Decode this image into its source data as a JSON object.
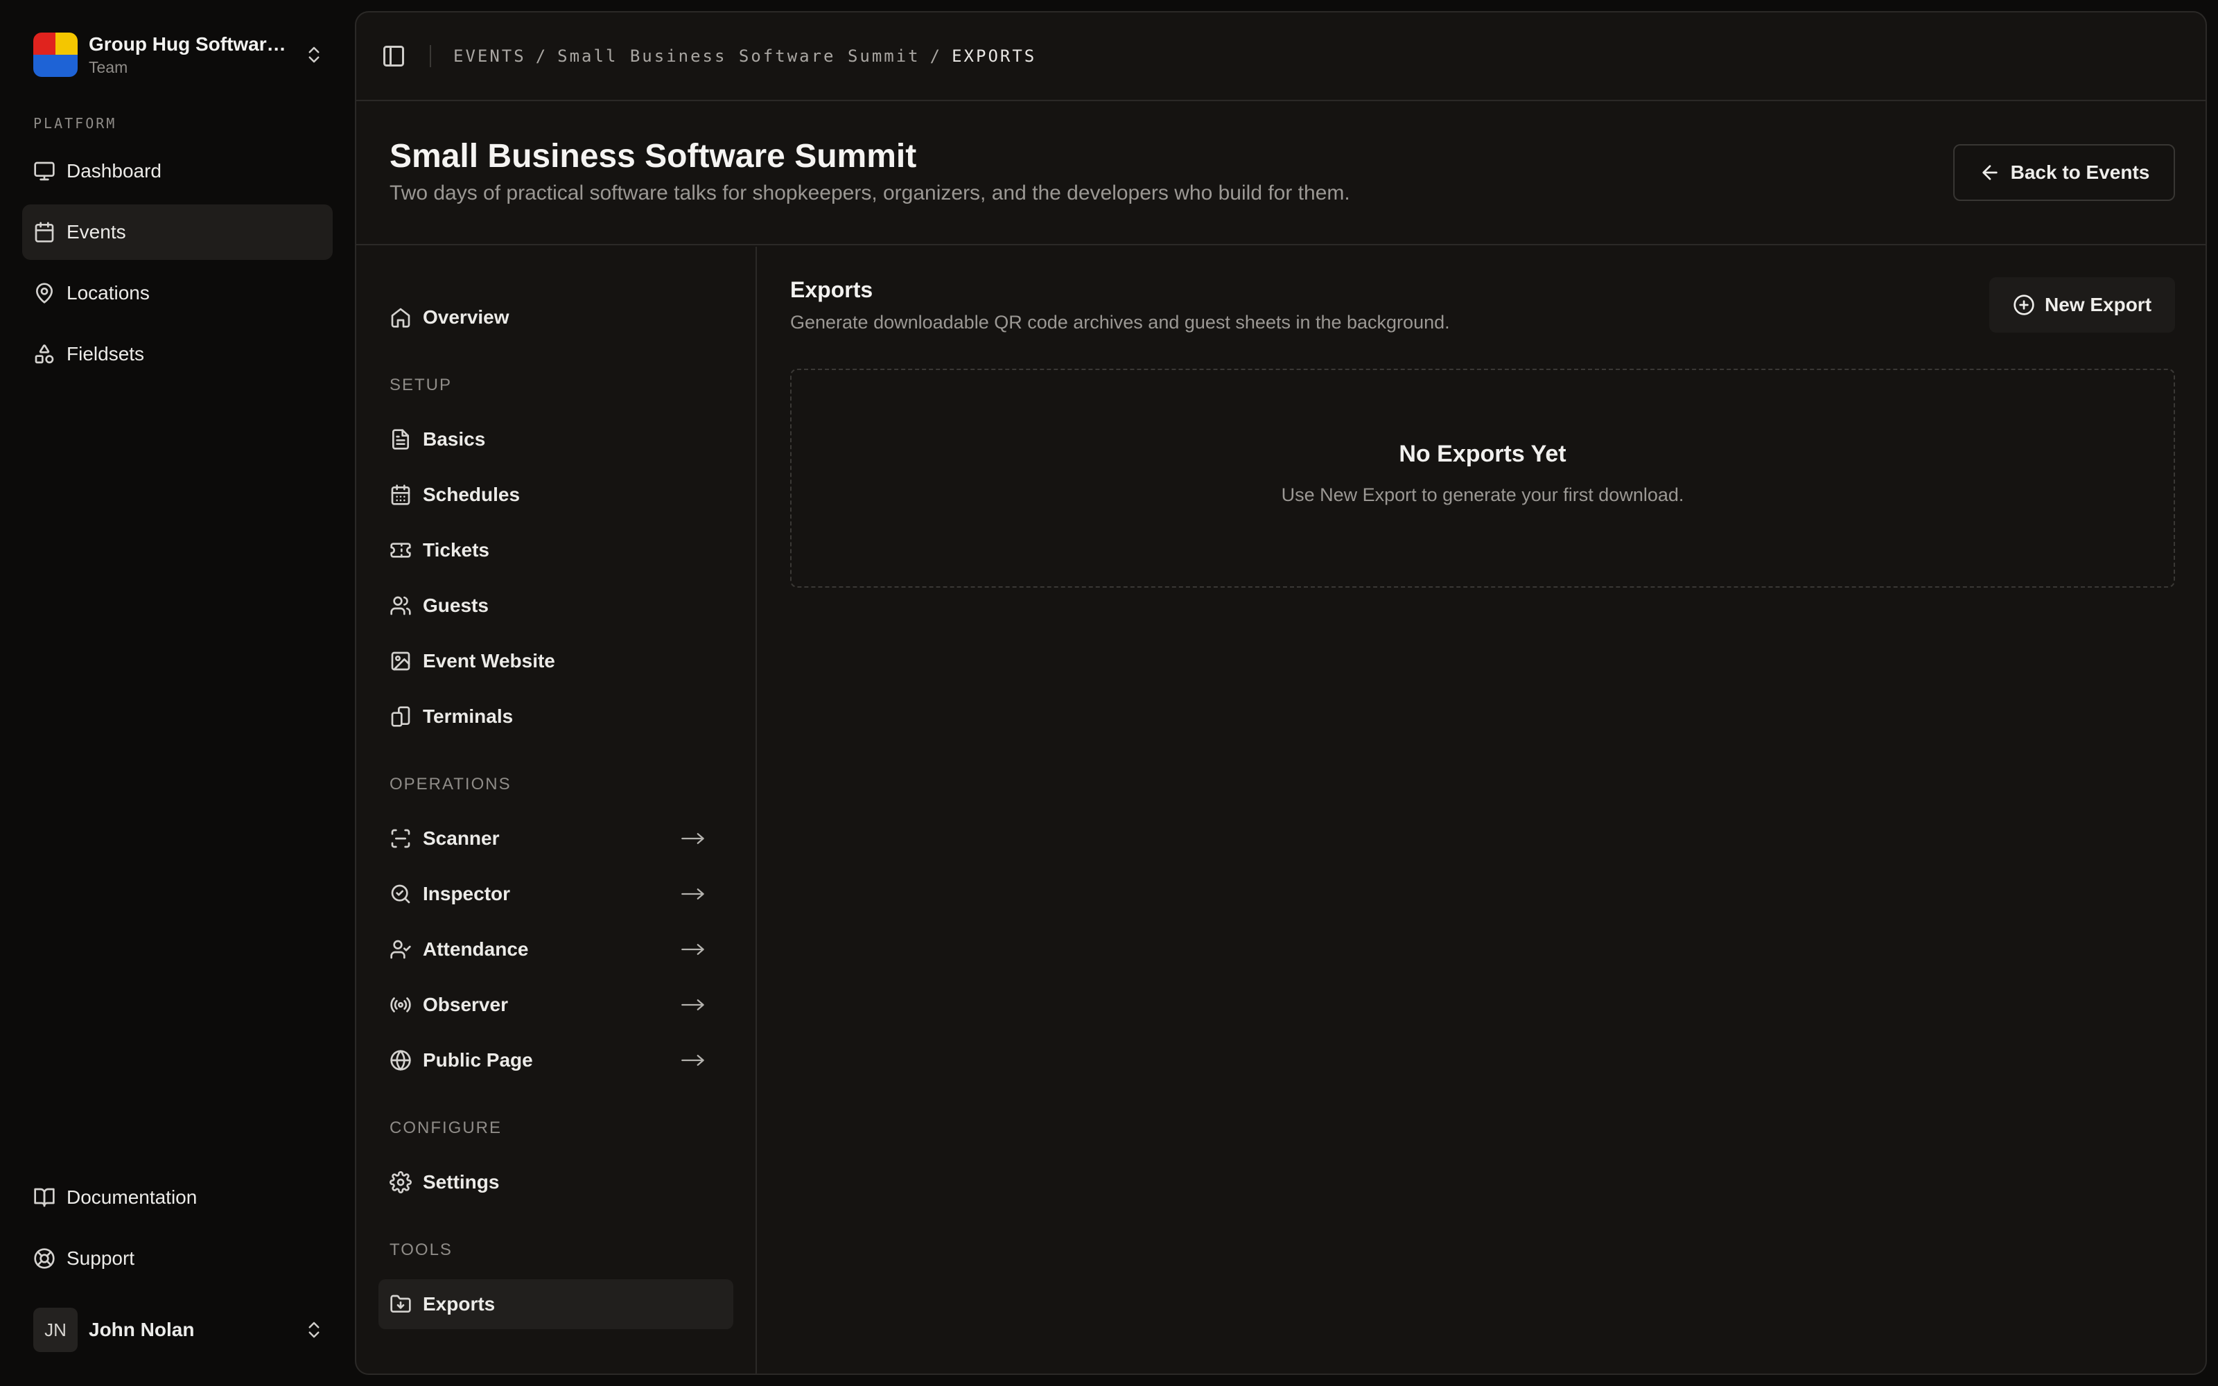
{
  "team": {
    "name": "Group Hug Software...",
    "role": "Team"
  },
  "sidebar": {
    "section_label": "PLATFORM",
    "items": [
      {
        "label": "Dashboard",
        "icon": "monitor-icon"
      },
      {
        "label": "Events",
        "icon": "calendar-icon",
        "active": true
      },
      {
        "label": "Locations",
        "icon": "map-pin-icon"
      },
      {
        "label": "Fieldsets",
        "icon": "shapes-icon"
      }
    ],
    "bottom_items": [
      {
        "label": "Documentation",
        "icon": "book-icon"
      },
      {
        "label": "Support",
        "icon": "life-buoy-icon"
      }
    ]
  },
  "user": {
    "initials": "JN",
    "name": "John Nolan"
  },
  "breadcrumb": {
    "items": [
      "EVENTS",
      "Small Business Software Summit",
      "EXPORTS"
    ],
    "separator": "/"
  },
  "event": {
    "title": "Small Business Software Summit",
    "subtitle": "Two days of practical software talks for shopkeepers, organizers, and the developers who build for them.",
    "back_label": "Back to Events"
  },
  "subnav": {
    "overview": "Overview",
    "sections": {
      "setup": "SETUP",
      "operations": "OPERATIONS",
      "configure": "CONFIGURE",
      "tools": "TOOLS"
    },
    "setup_items": [
      "Basics",
      "Schedules",
      "Tickets",
      "Guests",
      "Event Website",
      "Terminals"
    ],
    "operations_items": [
      "Scanner",
      "Inspector",
      "Attendance",
      "Observer",
      "Public Page"
    ],
    "configure_items": [
      "Settings"
    ],
    "tools_items": [
      "Exports"
    ],
    "active": "Exports"
  },
  "exports": {
    "title": "Exports",
    "subtitle": "Generate downloadable QR code archives and guest sheets in the background.",
    "new_button": "New Export",
    "empty_title": "No Exports Yet",
    "empty_subtitle": "Use New Export to generate your first download."
  },
  "colors": {
    "background": "#0c0b0a",
    "panel": "#151311",
    "border": "#2b2927",
    "active_item": "#1f1d1b",
    "logo_red": "#e0231e",
    "logo_yellow": "#f4c600",
    "logo_blue": "#1e63d6"
  }
}
